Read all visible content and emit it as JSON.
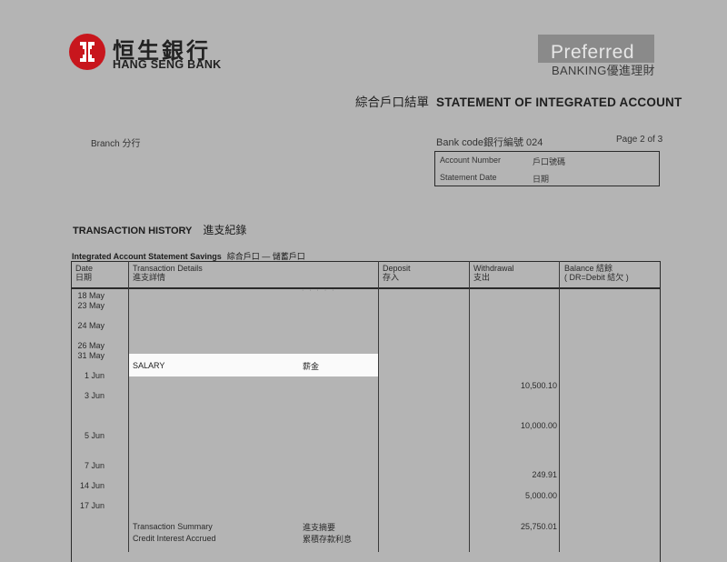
{
  "bank": {
    "name_cn": "恒生銀行",
    "name_en": "HANG SENG BANK"
  },
  "badge": {
    "word": "Preferred",
    "banking": "BANKING優進理財"
  },
  "statement": {
    "title_cn": "綜合戶口結單",
    "title_en": "STATEMENT OF INTEGRATED ACCOUNT",
    "branch": "Branch 分行",
    "bank_code": "Bank code銀行編號 024",
    "page": "Page 2 of 3",
    "account_number_label": "Account Number",
    "account_number_cn": "戶口號碼",
    "statement_date_label": "Statement Date",
    "statement_date_cn": "日期"
  },
  "section": {
    "heading_en": "TRANSACTION HISTORY",
    "heading_cn": "進支紀錄",
    "sub_en": "Integrated Account Statement Savings",
    "sub_cn": "綜合戶口 — 儲蓄戶口"
  },
  "chart_data": {
    "type": "table",
    "columns": [
      {
        "en": "Date",
        "cn": "日期"
      },
      {
        "en": "Transaction Details",
        "cn": "進支詳情"
      },
      {
        "en": "Deposit",
        "cn": "存入"
      },
      {
        "en": "Withdrawal",
        "cn": "支出"
      },
      {
        "en": "Balance 結餘",
        "cn": "( DR=Debit 結欠 )"
      }
    ],
    "dates": [
      "18 May",
      "23 May",
      "24 May",
      "26 May",
      "31 May",
      "1 Jun",
      "3 Jun",
      "5 Jun",
      "7 Jun",
      "14 Jun",
      "17 Jun"
    ],
    "highlighted_row": {
      "en": "SALARY",
      "cn": "薪金"
    },
    "withdrawals": [
      "10,500.10",
      "10,000.00",
      "249.91",
      "5,000.00",
      "25,750.01"
    ],
    "summary": {
      "transaction_summary_en": "Transaction Summary",
      "transaction_summary_cn": "進支摘要",
      "credit_interest_en": "Credit Interest Accrued",
      "credit_interest_cn": "累積存款利息"
    }
  }
}
